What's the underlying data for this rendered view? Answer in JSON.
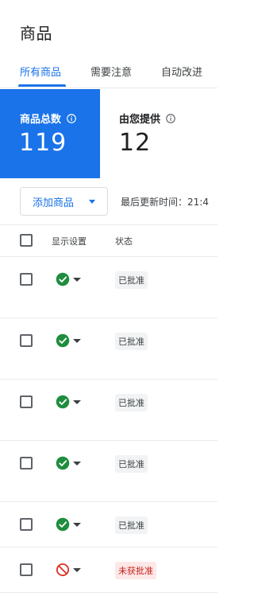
{
  "page": {
    "title": "商品"
  },
  "tabs": [
    {
      "label": "所有商品",
      "active": true
    },
    {
      "label": "需要注意",
      "active": false
    },
    {
      "label": "自动改进",
      "active": false
    }
  ],
  "stats": {
    "total": {
      "label": "商品总数",
      "value": "119",
      "icon": "info-icon"
    },
    "provided": {
      "label": "由您提供",
      "value": "12",
      "icon": "info-icon"
    }
  },
  "toolbar": {
    "add_label": "添加商品",
    "last_updated": "最后更新时间：21:4"
  },
  "table": {
    "headers": {
      "visibility": "显示设置",
      "status": "状态"
    },
    "rows": [
      {
        "visibility_icon": "check-circle-icon",
        "status": "已批准",
        "status_type": "approved"
      },
      {
        "visibility_icon": "check-circle-icon",
        "status": "已批准",
        "status_type": "approved"
      },
      {
        "visibility_icon": "check-circle-icon",
        "status": "已批准",
        "status_type": "approved"
      },
      {
        "visibility_icon": "check-circle-icon",
        "status": "已批准",
        "status_type": "approved"
      },
      {
        "visibility_icon": "check-circle-icon",
        "status": "已批准",
        "status_type": "approved"
      },
      {
        "visibility_icon": "blocked-icon",
        "status": "未获批准",
        "status_type": "rejected"
      }
    ]
  },
  "colors": {
    "accent": "#1a73e8",
    "approved_green": "#1e8e3e",
    "rejected_red": "#d93025"
  }
}
